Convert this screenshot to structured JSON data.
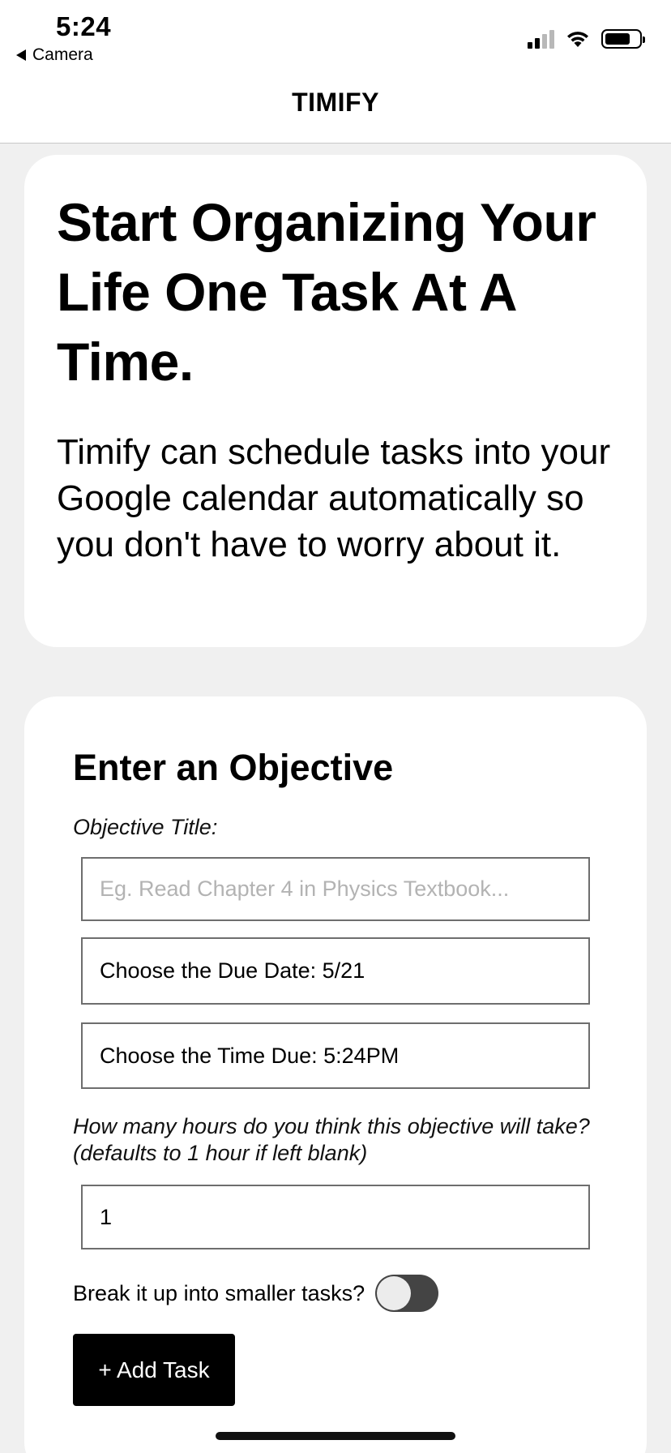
{
  "status_bar": {
    "time": "5:24",
    "back_label": "Camera"
  },
  "header": {
    "title": "TIMIFY"
  },
  "hero": {
    "title": "Start Organizing Your Life One Task At A Time.",
    "subtitle": "Timify can schedule tasks into your Google calendar automatically so you don't have to worry about it."
  },
  "form": {
    "title": "Enter an Objective",
    "objective_label": "Objective Title:",
    "objective_placeholder": "Eg. Read Chapter 4 in Physics Textbook...",
    "due_date": "Choose the Due Date: 5/21",
    "time_due": "Choose the Time Due: 5:24PM",
    "hours_label": "How many hours do you think this objective will take? (defaults to 1 hour if left blank)",
    "hours_value": "1",
    "break_label": "Break it up into smaller tasks?",
    "break_toggle_on": false,
    "add_button": "+ Add Task"
  },
  "icons": {
    "back": "back-triangle-icon",
    "signal": "cellular-signal-icon",
    "wifi": "wifi-icon",
    "battery": "battery-icon"
  }
}
